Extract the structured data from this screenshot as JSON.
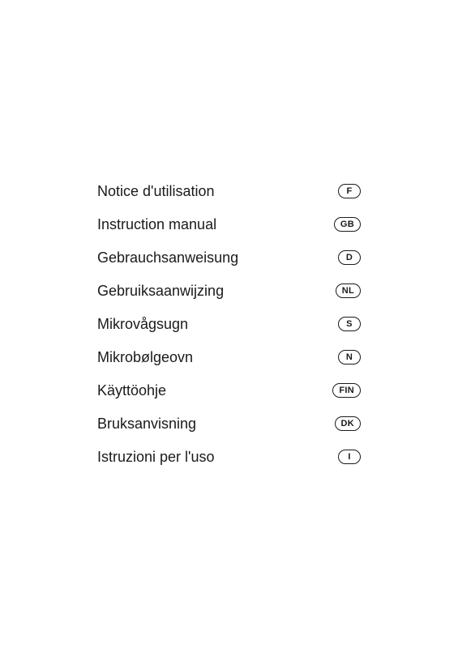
{
  "items": [
    {
      "label": "Notice d'utilisation",
      "badge": "F"
    },
    {
      "label": "Instruction manual",
      "badge": "GB"
    },
    {
      "label": "Gebrauchsanweisung",
      "badge": "D"
    },
    {
      "label": "Gebruiksaanwijzing",
      "badge": "NL"
    },
    {
      "label": "Mikrovågsugn",
      "badge": "S"
    },
    {
      "label": "Mikrobølgeovn",
      "badge": "N"
    },
    {
      "label": "Käyttöohje",
      "badge": "FIN"
    },
    {
      "label": "Bruksanvisning",
      "badge": "DK"
    },
    {
      "label": "Istruzioni per l'uso",
      "badge": "I"
    }
  ]
}
